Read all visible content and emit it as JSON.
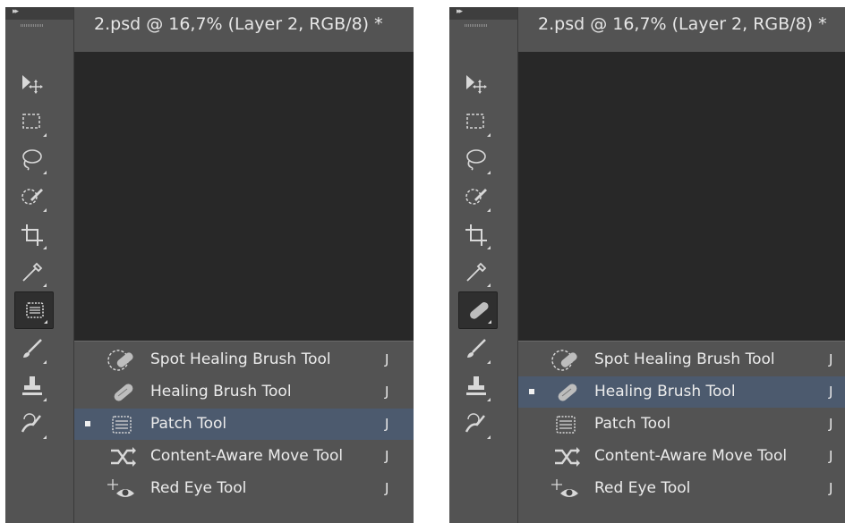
{
  "document_title": "2.psd @ 16,7% (Layer 2, RGB/8) *",
  "collapse_glyph": "▸▸",
  "colors": {
    "toolbar_bg": "#535353",
    "canvas_bg": "#282828",
    "selection_bg": "#4c5a6e",
    "text": "#ececec"
  },
  "toolbar_icons": [
    "move-tool-icon",
    "marquee-tool-icon",
    "lasso-tool-icon",
    "quick-selection-tool-icon",
    "crop-tool-icon",
    "eyedropper-tool-icon",
    "healing-tool-group-icon",
    "brush-tool-icon",
    "clone-stamp-tool-icon",
    "history-brush-tool-icon"
  ],
  "panels": [
    {
      "active_group_icon": "patch-tool-icon",
      "menu": [
        {
          "label": "Spot Healing Brush Tool",
          "shortcut": "J",
          "selected": false,
          "icon": "spot-healing-brush-icon"
        },
        {
          "label": "Healing Brush Tool",
          "shortcut": "J",
          "selected": false,
          "icon": "healing-brush-icon"
        },
        {
          "label": "Patch Tool",
          "shortcut": "J",
          "selected": true,
          "icon": "patch-tool-icon"
        },
        {
          "label": "Content-Aware Move Tool",
          "shortcut": "J",
          "selected": false,
          "icon": "content-aware-move-icon"
        },
        {
          "label": "Red Eye Tool",
          "shortcut": "J",
          "selected": false,
          "icon": "red-eye-icon"
        }
      ]
    },
    {
      "active_group_icon": "healing-brush-icon",
      "menu": [
        {
          "label": "Spot Healing Brush Tool",
          "shortcut": "J",
          "selected": false,
          "icon": "spot-healing-brush-icon"
        },
        {
          "label": "Healing Brush Tool",
          "shortcut": "J",
          "selected": true,
          "icon": "healing-brush-icon"
        },
        {
          "label": "Patch Tool",
          "shortcut": "J",
          "selected": false,
          "icon": "patch-tool-icon"
        },
        {
          "label": "Content-Aware Move Tool",
          "shortcut": "J",
          "selected": false,
          "icon": "content-aware-move-icon"
        },
        {
          "label": "Red Eye Tool",
          "shortcut": "J",
          "selected": false,
          "icon": "red-eye-icon"
        }
      ]
    }
  ]
}
